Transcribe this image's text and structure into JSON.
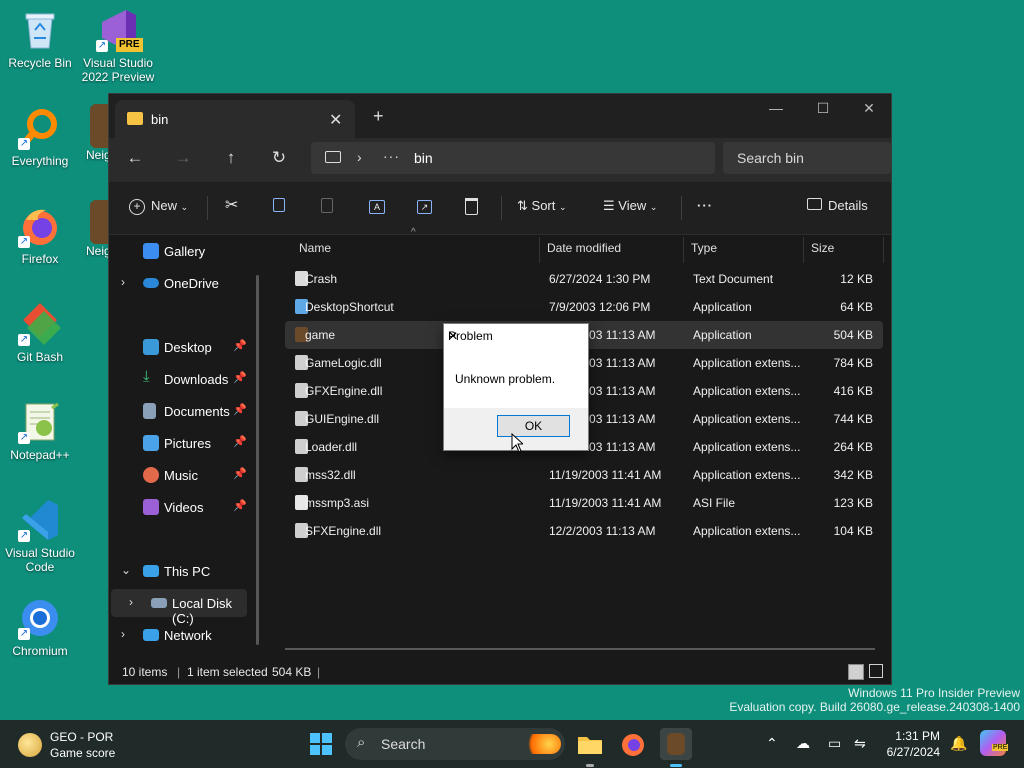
{
  "desktop": {
    "icons": [
      {
        "label": "Recycle Bin"
      },
      {
        "label": "Visual Studio 2022 Preview"
      },
      {
        "label": "Everything"
      },
      {
        "label": "Firefox"
      },
      {
        "label": "Git Bash"
      },
      {
        "label": "Notepad++"
      },
      {
        "label": "Visual Studio Code"
      },
      {
        "label": "Chromium"
      },
      {
        "label": "Neig"
      },
      {
        "label": "Neig"
      }
    ],
    "vs_badge": "PRE"
  },
  "explorer": {
    "tab_title": "bin",
    "address": {
      "path": "bin",
      "ellipsis": "···"
    },
    "search_placeholder": "Search bin",
    "toolbar": {
      "new": "New",
      "sort": "Sort",
      "view": "View",
      "more": "···",
      "details": "Details"
    },
    "nav": {
      "gallery": "Gallery",
      "onedrive": "OneDrive",
      "desktop": "Desktop",
      "downloads": "Downloads",
      "documents": "Documents",
      "pictures": "Pictures",
      "music": "Music",
      "videos": "Videos",
      "thispc": "This PC",
      "localdisk": "Local Disk (C:)",
      "network": "Network"
    },
    "columns": {
      "name": "Name",
      "date": "Date modified",
      "type": "Type",
      "size": "Size"
    },
    "files": [
      {
        "name": "Crash",
        "date": "6/27/2024 1:30 PM",
        "type": "Text Document",
        "size": "12 KB"
      },
      {
        "name": "DesktopShortcut",
        "date": "7/9/2003 12:06 PM",
        "type": "Application",
        "size": "64 KB"
      },
      {
        "name": "game",
        "date": "12/2/2003 11:13 AM",
        "type": "Application",
        "size": "504 KB"
      },
      {
        "name": "GameLogic.dll",
        "date": "12/2/2003 11:13 AM",
        "type": "Application extens...",
        "size": "784 KB"
      },
      {
        "name": "GFXEngine.dll",
        "date": "12/2/2003 11:13 AM",
        "type": "Application extens...",
        "size": "416 KB"
      },
      {
        "name": "GUIEngine.dll",
        "date": "12/2/2003 11:13 AM",
        "type": "Application extens...",
        "size": "744 KB"
      },
      {
        "name": "Loader.dll",
        "date": "12/2/2003 11:13 AM",
        "type": "Application extens...",
        "size": "264 KB"
      },
      {
        "name": "mss32.dll",
        "date": "11/19/2003 11:41 AM",
        "type": "Application extens...",
        "size": "342 KB"
      },
      {
        "name": "mssmp3.asi",
        "date": "11/19/2003 11:41 AM",
        "type": "ASI File",
        "size": "123 KB"
      },
      {
        "name": "SFXEngine.dll",
        "date": "12/2/2003 11:13 AM",
        "type": "Application extens...",
        "size": "104 KB"
      }
    ],
    "status": {
      "items": "10 items",
      "selected": "1 item selected",
      "size": "504 KB"
    }
  },
  "dialog": {
    "title": "Problem",
    "message": "Unknown problem.",
    "ok": "OK"
  },
  "watermark": {
    "line1": "Windows 11 Pro Insider Preview",
    "line2": "Evaluation copy. Build 26080.ge_release.240308-1400"
  },
  "taskbar": {
    "weather_title": "GEO - POR",
    "weather_sub": "Game score",
    "search": "Search",
    "time": "1:31 PM",
    "date": "6/27/2024"
  },
  "colors": {
    "desktop_bg": "#0e8f7c",
    "accent": "#0078d7",
    "folder": "#f6c344"
  }
}
